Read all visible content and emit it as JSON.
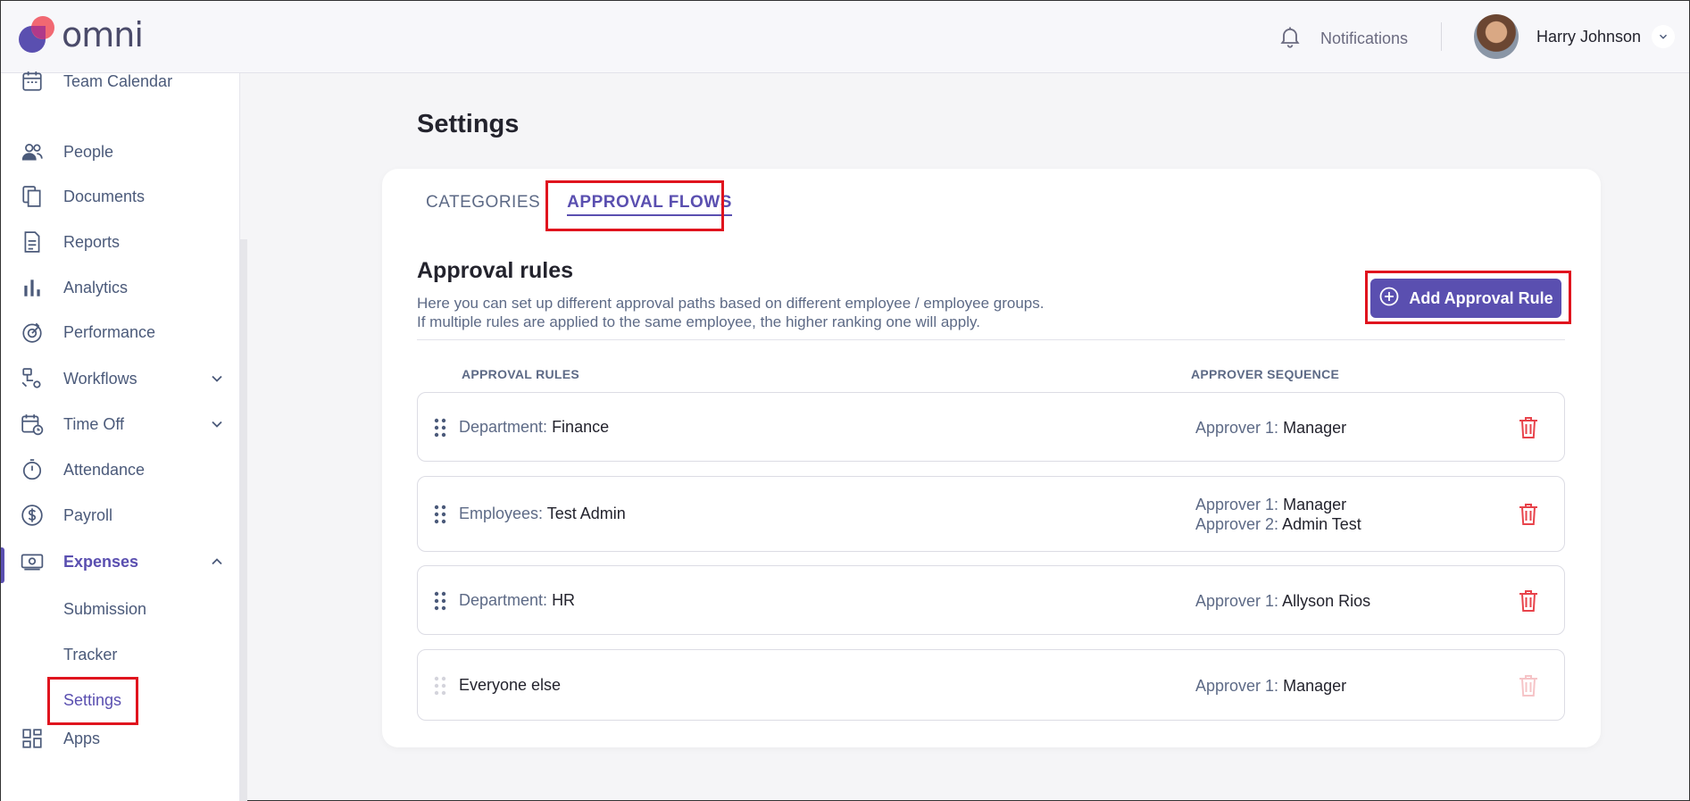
{
  "app": {
    "logo_text": "omni"
  },
  "header": {
    "notifications_label": "Notifications",
    "user_name": "Harry Johnson"
  },
  "sidebar": {
    "items": [
      {
        "label": "Team Calendar",
        "icon": "calendar-icon"
      },
      {
        "label": "People",
        "icon": "people-icon"
      },
      {
        "label": "Documents",
        "icon": "documents-icon"
      },
      {
        "label": "Reports",
        "icon": "report-icon"
      },
      {
        "label": "Analytics",
        "icon": "bar-chart-icon"
      },
      {
        "label": "Performance",
        "icon": "performance-icon"
      },
      {
        "label": "Workflows",
        "icon": "workflow-icon"
      },
      {
        "label": "Time Off",
        "icon": "calendar-clock-icon"
      },
      {
        "label": "Attendance",
        "icon": "stopwatch-icon"
      },
      {
        "label": "Payroll",
        "icon": "dollar-icon"
      },
      {
        "label": "Expenses",
        "icon": "money-icon"
      },
      {
        "label": "Apps",
        "icon": "apps-grid-icon"
      }
    ],
    "expenses_sub": [
      "Submission",
      "Tracker",
      "Settings"
    ]
  },
  "main": {
    "title": "Settings",
    "tabs": [
      "CATEGORIES",
      "APPROVAL FLOWS"
    ],
    "active_tab": "APPROVAL FLOWS",
    "section_title": "Approval rules",
    "desc_line1": "Here you can set up different approval paths based on different employee / employee groups.",
    "desc_line2": "If multiple rules are applied to the same employee, the higher ranking one will apply.",
    "add_button": "Add Approval Rule",
    "col_rules": "APPROVAL RULES",
    "col_sequence": "APPROVER SEQUENCE",
    "rules": [
      {
        "key": "Department:",
        "value": "Finance",
        "approvers": [
          {
            "k": "Approver 1:",
            "v": "Manager"
          }
        ]
      },
      {
        "key": "Employees:",
        "value": "Test Admin",
        "approvers": [
          {
            "k": "Approver 1:",
            "v": "Manager"
          },
          {
            "k": "Approver 2:",
            "v": "Admin Test"
          }
        ]
      },
      {
        "key": "Department:",
        "value": "HR",
        "approvers": [
          {
            "k": "Approver 1:",
            "v": "Allyson Rios"
          }
        ]
      },
      {
        "key": "",
        "value": "Everyone else",
        "approvers": [
          {
            "k": "Approver 1:",
            "v": "Manager"
          }
        ]
      }
    ]
  },
  "colors": {
    "accent": "#5a4fb0",
    "danger": "#e8434b",
    "highlight": "#e0141e"
  }
}
